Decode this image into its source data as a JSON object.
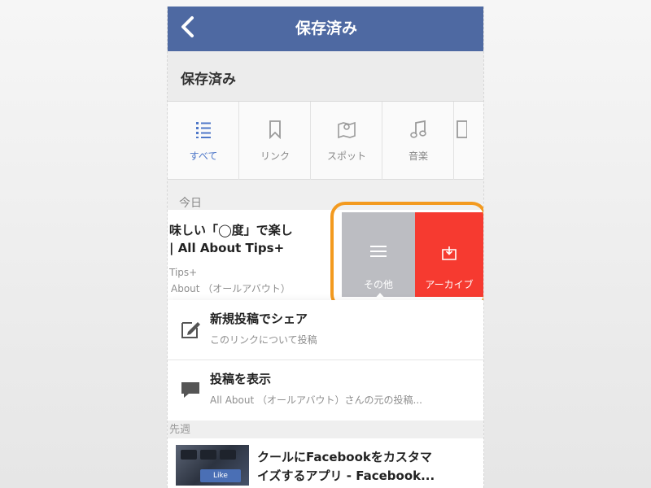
{
  "nav": {
    "back_glyph": "‹",
    "title": "保存済み"
  },
  "section_header": "保存済み",
  "tabs": [
    {
      "label": "すべて",
      "icon": "list-icon",
      "active": true
    },
    {
      "label": "リンク",
      "icon": "bookmark-icon",
      "active": false
    },
    {
      "label": "スポット",
      "icon": "map-pin-icon",
      "active": false
    },
    {
      "label": "音楽",
      "icon": "music-note-icon",
      "active": false
    },
    {
      "label": "",
      "icon": "book-icon",
      "active": false
    }
  ],
  "today_label": "今日",
  "item": {
    "title_line1": "味しい「◯度」で楽し",
    "title_line2": "| All About Tips+",
    "source1": "Tips+",
    "source2": "About （オールアバウト）"
  },
  "swipe_actions": {
    "more_label": "その他",
    "more_icon": "menu-lines-icon",
    "archive_label": "アーカイブ",
    "archive_icon": "archive-box-icon",
    "archive_color": "#f63a30",
    "highlight_color": "#f39a1f"
  },
  "menu": {
    "share": {
      "title": "新規投稿でシェア",
      "subtitle": "このリンクについて投稿",
      "icon": "compose-icon"
    },
    "view_post": {
      "title": "投稿を表示",
      "subtitle": "All About （オールアバウト）さんの元の投稿...",
      "icon": "speech-bubble-icon"
    }
  },
  "older_label": "先週",
  "bottom_item": {
    "title_line1": "クールにFacebookをカスタマ",
    "title_line2": "イズするアプリ - Facebook...",
    "thumb_text": "Like"
  },
  "colors": {
    "nav_bg": "#4e69a2",
    "active_tab": "#4e77c8"
  }
}
